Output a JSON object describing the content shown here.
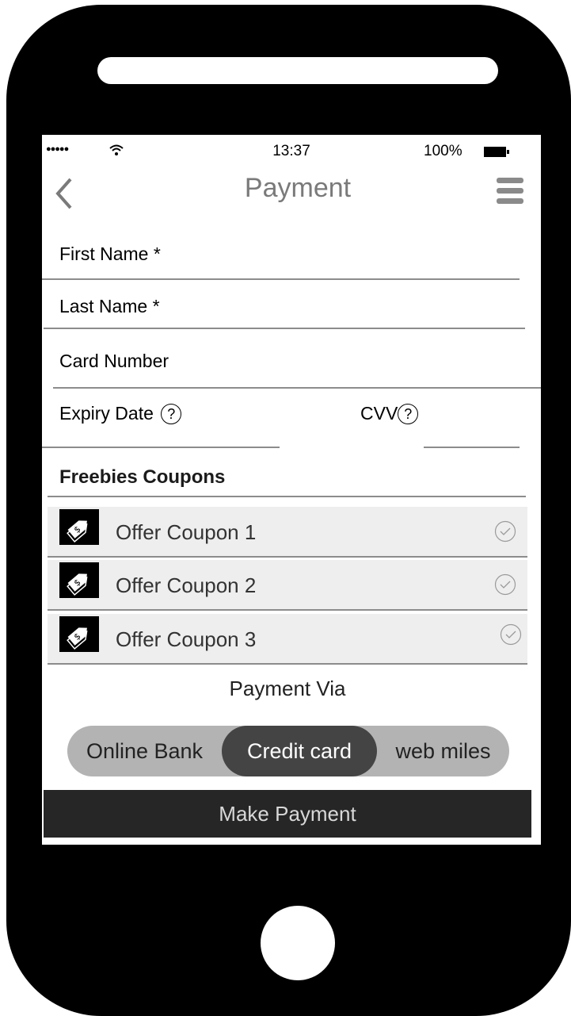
{
  "status_bar": {
    "signal_dots": "●●●●●",
    "time": "13:37",
    "battery": "100%"
  },
  "header": {
    "title": "Payment",
    "back_icon": "chevron-left-icon",
    "menu_icon": "hamburger-menu-icon"
  },
  "form": {
    "first_name_label": "First Name *",
    "last_name_label": "Last Name *",
    "card_number_label": "Card Number",
    "expiry_label": "Expiry Date",
    "cvv_label": "CVV",
    "help_glyph": "?"
  },
  "coupons": {
    "title": "Freebies Coupons",
    "items": [
      {
        "label": "Offer Coupon 1"
      },
      {
        "label": "Offer Coupon 2"
      },
      {
        "label": "Offer Coupon 3"
      }
    ]
  },
  "payment": {
    "via_label": "Payment Via",
    "options": [
      "Online Bank",
      "Credit  card",
      "web miles"
    ],
    "selected": "Credit  card",
    "submit_label": "Make Payment"
  },
  "colors": {
    "accent": "#444444",
    "row_bg": "#eeeeee",
    "button_bg": "#262626"
  }
}
